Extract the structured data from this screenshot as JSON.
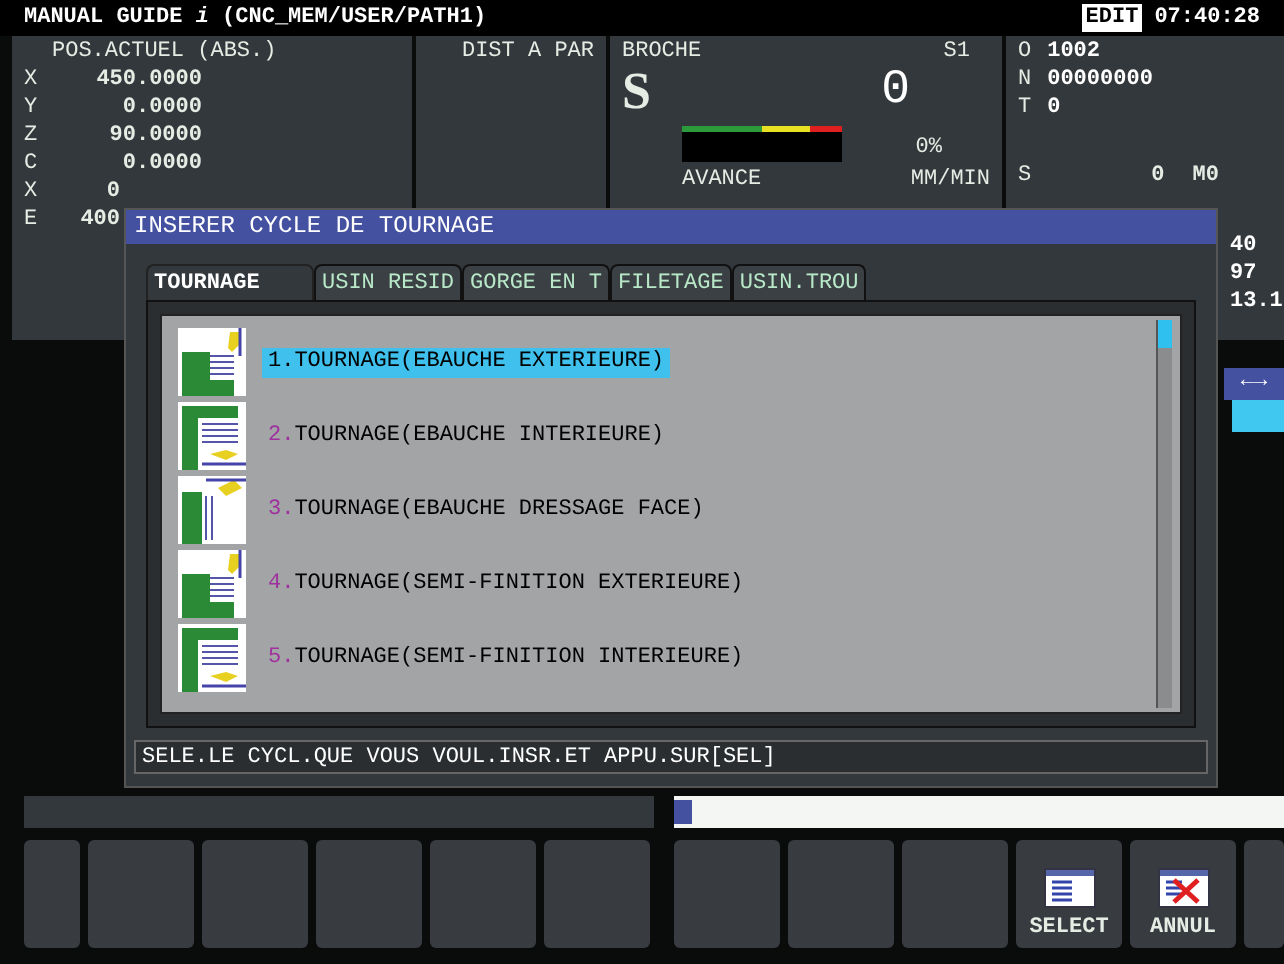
{
  "header": {
    "title": "MANUAL GUIDE *i* (CNC_MEM/USER/PATH1)",
    "mode": "EDIT",
    "time": "07:40:28"
  },
  "position": {
    "title": "POS.ACTUEL (ABS.)",
    "axes": [
      {
        "axis": "X",
        "value": "450.0000"
      },
      {
        "axis": "Y",
        "value": "0.0000"
      },
      {
        "axis": "Z",
        "value": "90.0000"
      },
      {
        "axis": "C",
        "value": "0.0000"
      },
      {
        "axis": "X",
        "value": "0",
        "cut": true
      },
      {
        "axis": "E",
        "value": "400",
        "cut": true
      }
    ]
  },
  "distance": {
    "title": "DIST A PAR"
  },
  "spindle": {
    "title": "BROCHE",
    "channel": "S1",
    "letter": "S",
    "speed": "0",
    "level": 0,
    "percent": "0%",
    "feed_title": "AVANCE",
    "feed_unit": "MM/MIN"
  },
  "program": {
    "lines": [
      {
        "label": "O",
        "value": "1002"
      },
      {
        "label": "N",
        "value": "00000000"
      },
      {
        "label": "T",
        "value": "0"
      }
    ],
    "spindle_label": "S",
    "spindle_value": "0",
    "m_code": "M0"
  },
  "side_values": [
    "40",
    "97",
    "13.1"
  ],
  "side_tab": "←→",
  "dialog": {
    "title": "INSERER CYCLE DE TOURNAGE",
    "tabs": [
      {
        "label": "TOURNAGE",
        "selected": true
      },
      {
        "label": "USIN RESID",
        "selected": false
      },
      {
        "label": "GORGE EN T",
        "selected": false
      },
      {
        "label": "FILETAGE",
        "selected": false
      },
      {
        "label": "USIN.TROU",
        "selected": false
      }
    ],
    "items": [
      {
        "number": "1.",
        "text": "TOURNAGE(EBAUCHE EXTERIEURE)",
        "kind": "exterior",
        "selected": true
      },
      {
        "number": "2.",
        "text": "TOURNAGE(EBAUCHE INTERIEURE)",
        "kind": "interior",
        "selected": false
      },
      {
        "number": "3.",
        "text": "TOURNAGE(EBAUCHE DRESSAGE FACE)",
        "kind": "face",
        "selected": false
      },
      {
        "number": "4.",
        "text": "TOURNAGE(SEMI-FINITION EXTERIEURE)",
        "kind": "exterior",
        "selected": false
      },
      {
        "number": "5.",
        "text": "TOURNAGE(SEMI-FINITION INTERIEURE)",
        "kind": "interior",
        "selected": false
      }
    ],
    "message": "SELE.LE CYCL.QUE VOUS VOUL.INSR.ET APPU.SUR[SEL]"
  },
  "softkeys": [
    {
      "kind": "blank"
    },
    {
      "kind": "blank"
    },
    {
      "kind": "blank"
    },
    {
      "kind": "blank"
    },
    {
      "kind": "blank"
    },
    {
      "kind": "blank"
    },
    {
      "kind": "blank"
    },
    {
      "kind": "blank"
    },
    {
      "kind": "blank"
    },
    {
      "kind": "select",
      "label": "SELECT"
    },
    {
      "kind": "cancel",
      "label": "ANNUL"
    },
    {
      "kind": "blank"
    }
  ]
}
